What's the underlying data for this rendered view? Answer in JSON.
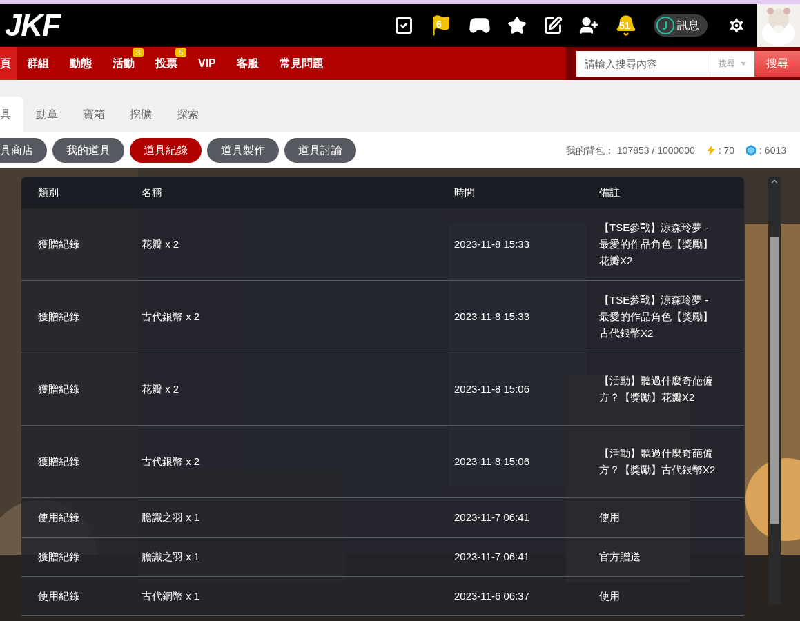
{
  "header": {
    "logo": "JKF",
    "icons": [
      {
        "kind": "check"
      },
      {
        "kind": "flag",
        "badge": "6"
      },
      {
        "kind": "gamepad"
      },
      {
        "kind": "star"
      },
      {
        "kind": "edit"
      },
      {
        "kind": "user-add"
      },
      {
        "kind": "bell",
        "badge": "51"
      },
      {
        "kind": "message",
        "label": "訊息"
      },
      {
        "kind": "settings"
      }
    ]
  },
  "nav": {
    "items": [
      {
        "label": "頁",
        "selected": true
      },
      {
        "label": "群組",
        "selected": false
      },
      {
        "label": "動態",
        "selected": false
      },
      {
        "label": "活動",
        "selected": false,
        "badge": "3"
      },
      {
        "label": "投票",
        "selected": false,
        "badge": "5"
      },
      {
        "label": "VIP",
        "selected": false
      },
      {
        "label": "客服",
        "selected": false
      },
      {
        "label": "常見問題",
        "selected": false
      }
    ],
    "search": {
      "placeholder": "請輸入搜尋內容",
      "scope": "搜尋",
      "button": "搜尋"
    }
  },
  "tabs": [
    {
      "label": "具",
      "selected": true
    },
    {
      "label": "動章",
      "selected": false
    },
    {
      "label": "寶箱",
      "selected": false
    },
    {
      "label": "挖礦",
      "selected": false
    },
    {
      "label": "探索",
      "selected": false
    }
  ],
  "subtabs": [
    {
      "label": "具商店",
      "selected": false
    },
    {
      "label": "我的道具",
      "selected": false
    },
    {
      "label": "道具紀錄",
      "selected": true
    },
    {
      "label": "道具製作",
      "selected": false
    },
    {
      "label": "道具討論",
      "selected": false
    }
  ],
  "stats": {
    "bag_label": "我的背包：",
    "bag_value": "107853 / 1000000",
    "energy": ": 70",
    "gems": ": 6013"
  },
  "table": {
    "columns": [
      "類別",
      "名稱",
      "時間",
      "備註"
    ],
    "rows": [
      [
        "獲贈紀錄",
        "花瓣 x 2",
        "2023-11-8 15:33",
        "【TSE參戰】涼森玲夢 - 最愛的作品角色【獎勵】花瓣X2"
      ],
      [
        "獲贈紀錄",
        "古代銀幣 x 2",
        "2023-11-8 15:33",
        "【TSE參戰】涼森玲夢 - 最愛的作品角色【獎勵】古代銀幣X2"
      ],
      [
        "獲贈紀錄",
        "花瓣 x 2",
        "2023-11-8 15:06",
        "【活動】聽過什麼奇葩偏方？【獎勵】花瓣X2"
      ],
      [
        "獲贈紀錄",
        "古代銀幣 x 2",
        "2023-11-8 15:06",
        "【活動】聽過什麼奇葩偏方？【獎勵】古代銀幣X2"
      ],
      [
        "使用紀錄",
        "膽識之羽 x 1",
        "2023-11-7 06:41",
        "使用"
      ],
      [
        "獲贈紀錄",
        "膽識之羽 x 1",
        "2023-11-7 06:41",
        "官方贈送"
      ],
      [
        "使用紀錄",
        "古代銅幣 x 1",
        "2023-11-6 06:37",
        "使用"
      ]
    ]
  }
}
